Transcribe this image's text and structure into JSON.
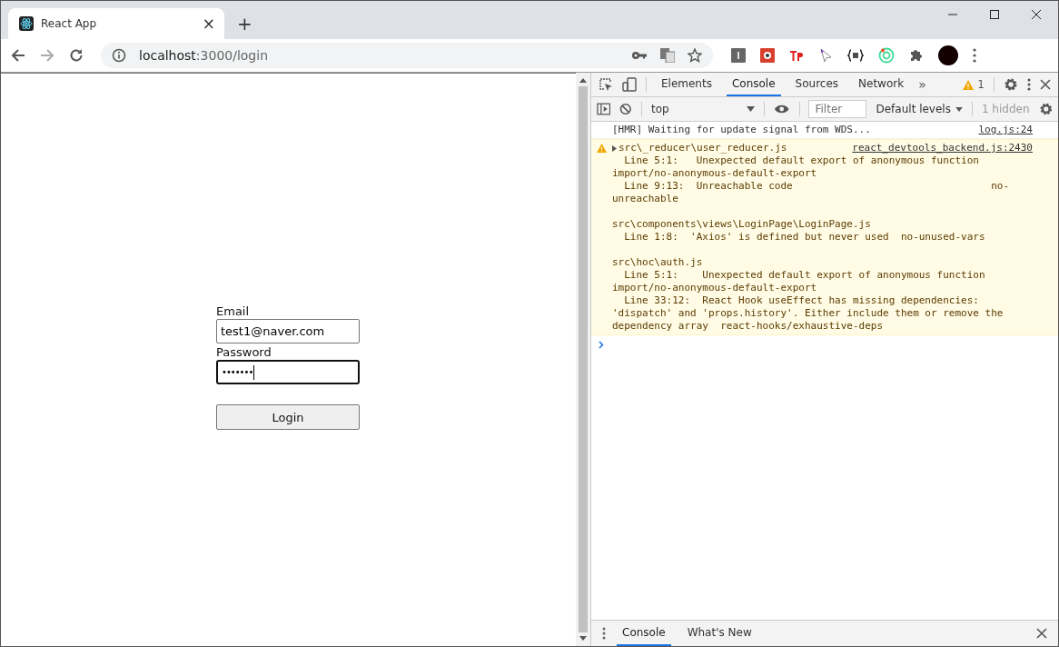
{
  "browser_tab": {
    "title": "React App",
    "close": "×",
    "new_tab": "+"
  },
  "address_bar": {
    "host": "localhost",
    "path": ":3000/login"
  },
  "login_form": {
    "email_label": "Email",
    "email_value": "test1@naver.com",
    "password_label": "Password",
    "password_value": "•••••••",
    "button": "Login"
  },
  "devtools": {
    "tabs": [
      {
        "label": "Elements",
        "selected": false
      },
      {
        "label": "Console",
        "selected": true
      },
      {
        "label": "Sources",
        "selected": false
      },
      {
        "label": "Network",
        "selected": false
      }
    ],
    "more": "»",
    "warning_count": "1",
    "console_toolbar": {
      "context": "top",
      "filter_placeholder": "Filter",
      "levels": "Default levels",
      "hidden": "1 hidden"
    },
    "messages": [
      {
        "kind": "log",
        "text": "[HMR] Waiting for update signal from WDS...",
        "source": "log.js:24"
      },
      {
        "kind": "warning",
        "text": "src\\_reducer\\user_reducer.js",
        "source": "react_devtools_backend.js:2430",
        "groups": [
          [
            "  Line 5:1:   Unexpected default export of anonymous function",
            "import/no-anonymous-default-export",
            "  Line 9:13:  Unreachable code                                 no-",
            "unreachable"
          ],
          [
            "src\\components\\views\\LoginPage\\LoginPage.js",
            "  Line 1:8:  'Axios' is defined but never used  no-unused-vars"
          ],
          [
            "src\\hoc\\auth.js",
            "  Line 5:1:    Unexpected default export of anonymous function",
            "import/no-anonymous-default-export",
            "  Line 33:12:  React Hook useEffect has missing dependencies:",
            "'dispatch' and 'props.history'. Either include them or remove the",
            "dependency array  react-hooks/exhaustive-deps"
          ]
        ]
      }
    ],
    "drawer_tabs": [
      {
        "label": "Console",
        "selected": true
      },
      {
        "label": "What's New",
        "selected": false
      }
    ]
  }
}
